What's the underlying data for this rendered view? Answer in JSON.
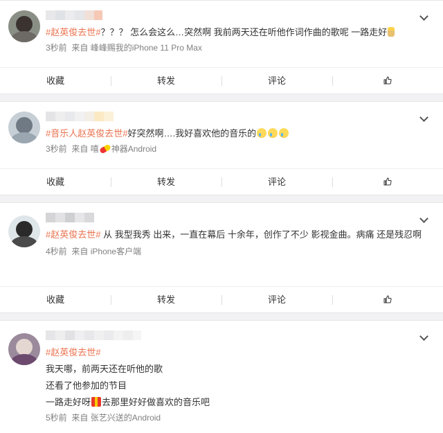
{
  "posts": [
    {
      "text_parts": [
        {
          "t": "#赵英俊去世#",
          "topic": true
        },
        {
          "t": "？？？ 怎么会这么…突然啊 我前两天还在听他作词作曲的歌呢 一路走好",
          "topic": false
        }
      ],
      "emoji": "candle-emoji",
      "time": "3秒前",
      "source_prefix": "来自",
      "source": "峰峰赐我的iPhone 11 Pro Max"
    },
    {
      "text_parts": [
        {
          "t": "#音乐人赵英俊去世#",
          "topic": true
        },
        {
          "t": "好突然啊….我好喜欢他的音乐的",
          "topic": false
        }
      ],
      "emoji": "crying-emoji",
      "time": "3秒前",
      "source_prefix": "来自",
      "source_a": "嘻",
      "source_b": "神器Android"
    },
    {
      "text_parts": [
        {
          "t": "#赵英俊去世#",
          "topic": true
        },
        {
          "t": " 从 我型我秀 出来，一直在幕后 十余年，创作了不少 影视金曲。病痛 还是残忍啊",
          "topic": false
        }
      ],
      "time": "4秒前",
      "source_prefix": "来自",
      "source": "iPhone客户端"
    },
    {
      "topic": "#赵英俊去世#",
      "lines": [
        "我天哪，前两天还在听他的歌",
        "还看了他参加的节目",
        "一路走好呀",
        "去那里好好做喜欢的音乐吧"
      ],
      "time": "5秒前",
      "source_prefix": "来自",
      "source": "张艺兴送的Android"
    }
  ],
  "actions": {
    "favorite": "收藏",
    "repost": "转发",
    "comment": "评论"
  },
  "colors": {
    "topic": "#eb7350",
    "meta": "#808080",
    "background": "#f2f2f5"
  }
}
